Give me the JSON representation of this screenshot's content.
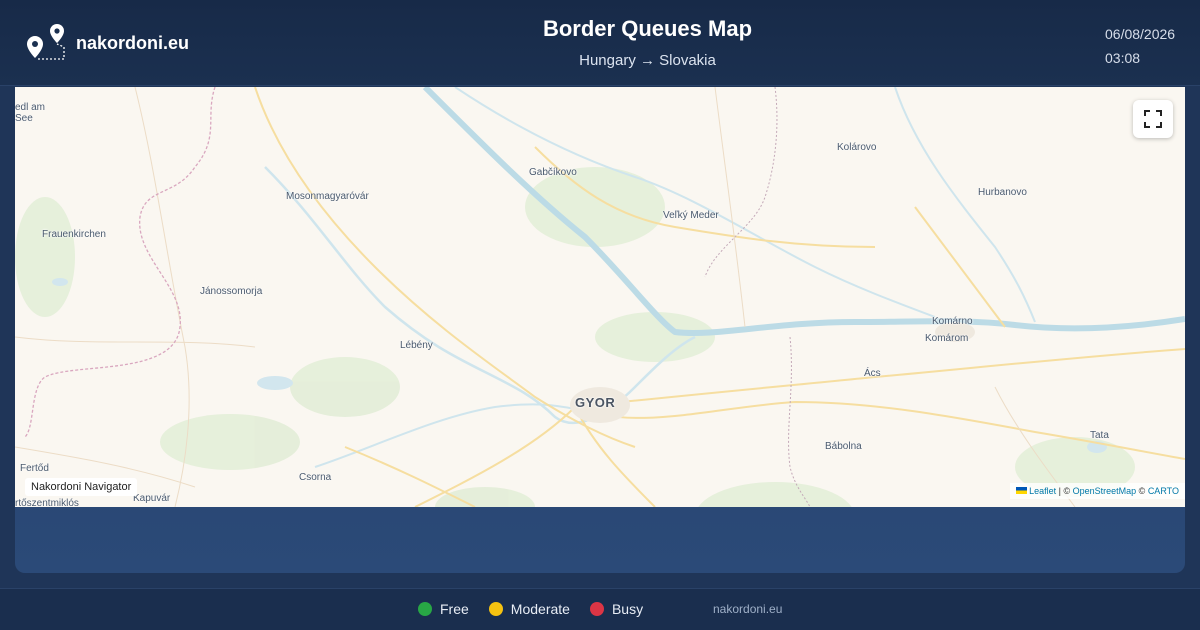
{
  "brand": {
    "name": "nakordoni.eu",
    "icon": "map-pins-route-icon"
  },
  "header": {
    "title": "Border Queues Map",
    "subtitle": "Hungary → Slovakia",
    "date": "06/08/2026",
    "time": "03:08"
  },
  "map": {
    "labels": {
      "neusiedl_1": "edl am",
      "neusiedl_2": "See",
      "gabcikovo": "Gabčíkovo",
      "kolarovo": "Kolárovo",
      "mosonmagyarovar": "Mosonmagyaróvár",
      "hurbanovo": "Hurbanovo",
      "velky_meder": "Veľký Meder",
      "frauenkirchen": "Frauenkirchen",
      "janossomorja": "Jánossomorja",
      "komarno": "Komárno",
      "komarom": "Komárom",
      "lebeny": "Lébény",
      "acs": "Ács",
      "gyor": "GYOR",
      "babolna": "Bábolna",
      "tata": "Tata",
      "fertod": "Fertőd",
      "csorna": "Csorna",
      "kapuvar": "Kapuvár",
      "fertoszentmiklos": "rtőszentmiklós"
    },
    "fullscreen_icon": "fullscreen-icon",
    "nav_badge": "Nakordoni Navigator",
    "attribution": {
      "leaflet": "Leaflet",
      "sep1": " | © ",
      "osm": "OpenStreetMap",
      "sep2": " © ",
      "carto": "CARTO"
    }
  },
  "legend": {
    "items": [
      {
        "label": "Free",
        "color": "#28a745"
      },
      {
        "label": "Moderate",
        "color": "#f5c211"
      },
      {
        "label": "Busy",
        "color": "#dc3545"
      }
    ],
    "site": "nakordoni.eu"
  }
}
